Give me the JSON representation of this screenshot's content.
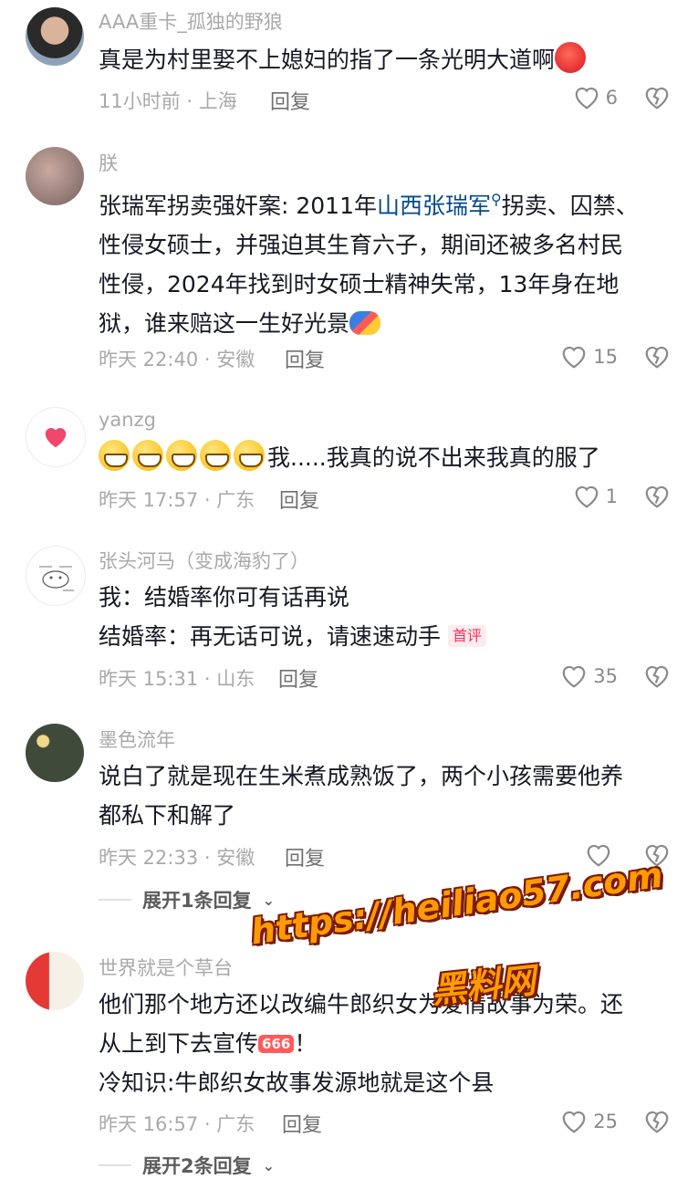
{
  "comments": [
    {
      "username": "AAA重卡_孤独的野狼",
      "lines": [
        "真是为村里娶不上媳妇的指了一条光明大道啊"
      ],
      "emoji_end": "angry-face",
      "time": "11小时前",
      "location": "上海",
      "reply_label": "回复",
      "likes": "6"
    },
    {
      "username": "朕",
      "line1_prefix": "张瑞军拐卖强奸案: 2011年",
      "line1_link": "山西张瑞军",
      "line1_suffix": "拐卖、囚禁、",
      "lines": [
        "性侵女硕士，并强迫其生育六子，期间还被多名村民",
        "性侵，2024年找到时女硕士精神失常，13年身在地",
        "狱，谁来赔这一生好光景"
      ],
      "time": "昨天 22:40",
      "location": "安徽",
      "reply_label": "回复",
      "likes": "15"
    },
    {
      "username": "yanzg",
      "lines": [
        "我.....我真的说不出来我真的服了"
      ],
      "time": "昨天 17:57",
      "location": "广东",
      "reply_label": "回复",
      "likes": "1"
    },
    {
      "username": "张头河马（变成海豹了）",
      "lines": [
        "我：结婚率你可有话再说",
        "结婚率：再无话可说，请速速动手"
      ],
      "badge": "首评",
      "time": "昨天 15:31",
      "location": "山东",
      "reply_label": "回复",
      "likes": "35"
    },
    {
      "username": "墨色流年",
      "lines": [
        "说白了就是现在生米煮成熟饭了，两个小孩需要他养",
        "都私下和解了"
      ],
      "time": "昨天 22:33",
      "location": "安徽",
      "reply_label": "回复",
      "likes": "",
      "expand_label": "展开1条回复"
    },
    {
      "username": "世界就是个草台",
      "lines": [
        "他们那个地方还以改编牛郎织女为爱情故事为荣。还",
        "从上到下去宣传",
        "冷知识:牛郎织女故事发源地就是这个县"
      ],
      "line2_badge": "666",
      "line2_suffix": "！",
      "time": "昨天 16:57",
      "location": "广东",
      "reply_label": "回复",
      "likes": "25",
      "expand_label": "展开2条回复"
    }
  ],
  "watermark": {
    "url": "https://heiliao57.com",
    "name": "黑料网"
  },
  "colors": {
    "text": "#161823",
    "meta": "#a9a9a9",
    "link": "#04498d",
    "badge": "#fe2c55",
    "watermark": "#ff9b00"
  }
}
